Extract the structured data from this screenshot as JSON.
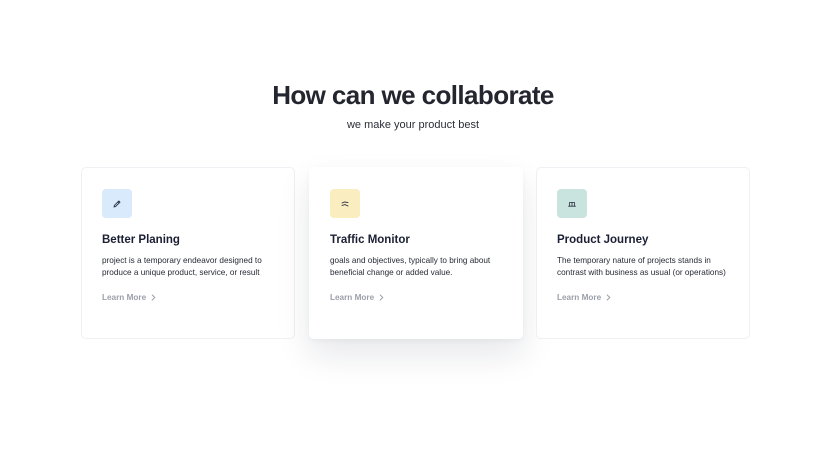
{
  "section": {
    "title": "How can we collaborate",
    "subtitle": "we make your product best"
  },
  "cards": [
    {
      "icon": "pencil-icon",
      "icon_bg": "#d8eafc",
      "title": "Better Planing",
      "text": "project is a temporary endeavor designed to produce a unique product, service, or result",
      "link": "Learn More"
    },
    {
      "icon": "chart-lines-icon",
      "icon_bg": "#faedbf",
      "title": "Traffic Monitor",
      "text": "goals and objectives, typically to bring about beneficial change or added value.",
      "link": "Learn More"
    },
    {
      "icon": "journey-icon",
      "icon_bg": "#c9e3df",
      "title": "Product Journey",
      "text": "The temporary nature of projects stands in contrast with business as usual (or operations)",
      "link": "Learn More"
    }
  ],
  "colors": {
    "heading": "#23252f",
    "link": "#9a9faa"
  }
}
